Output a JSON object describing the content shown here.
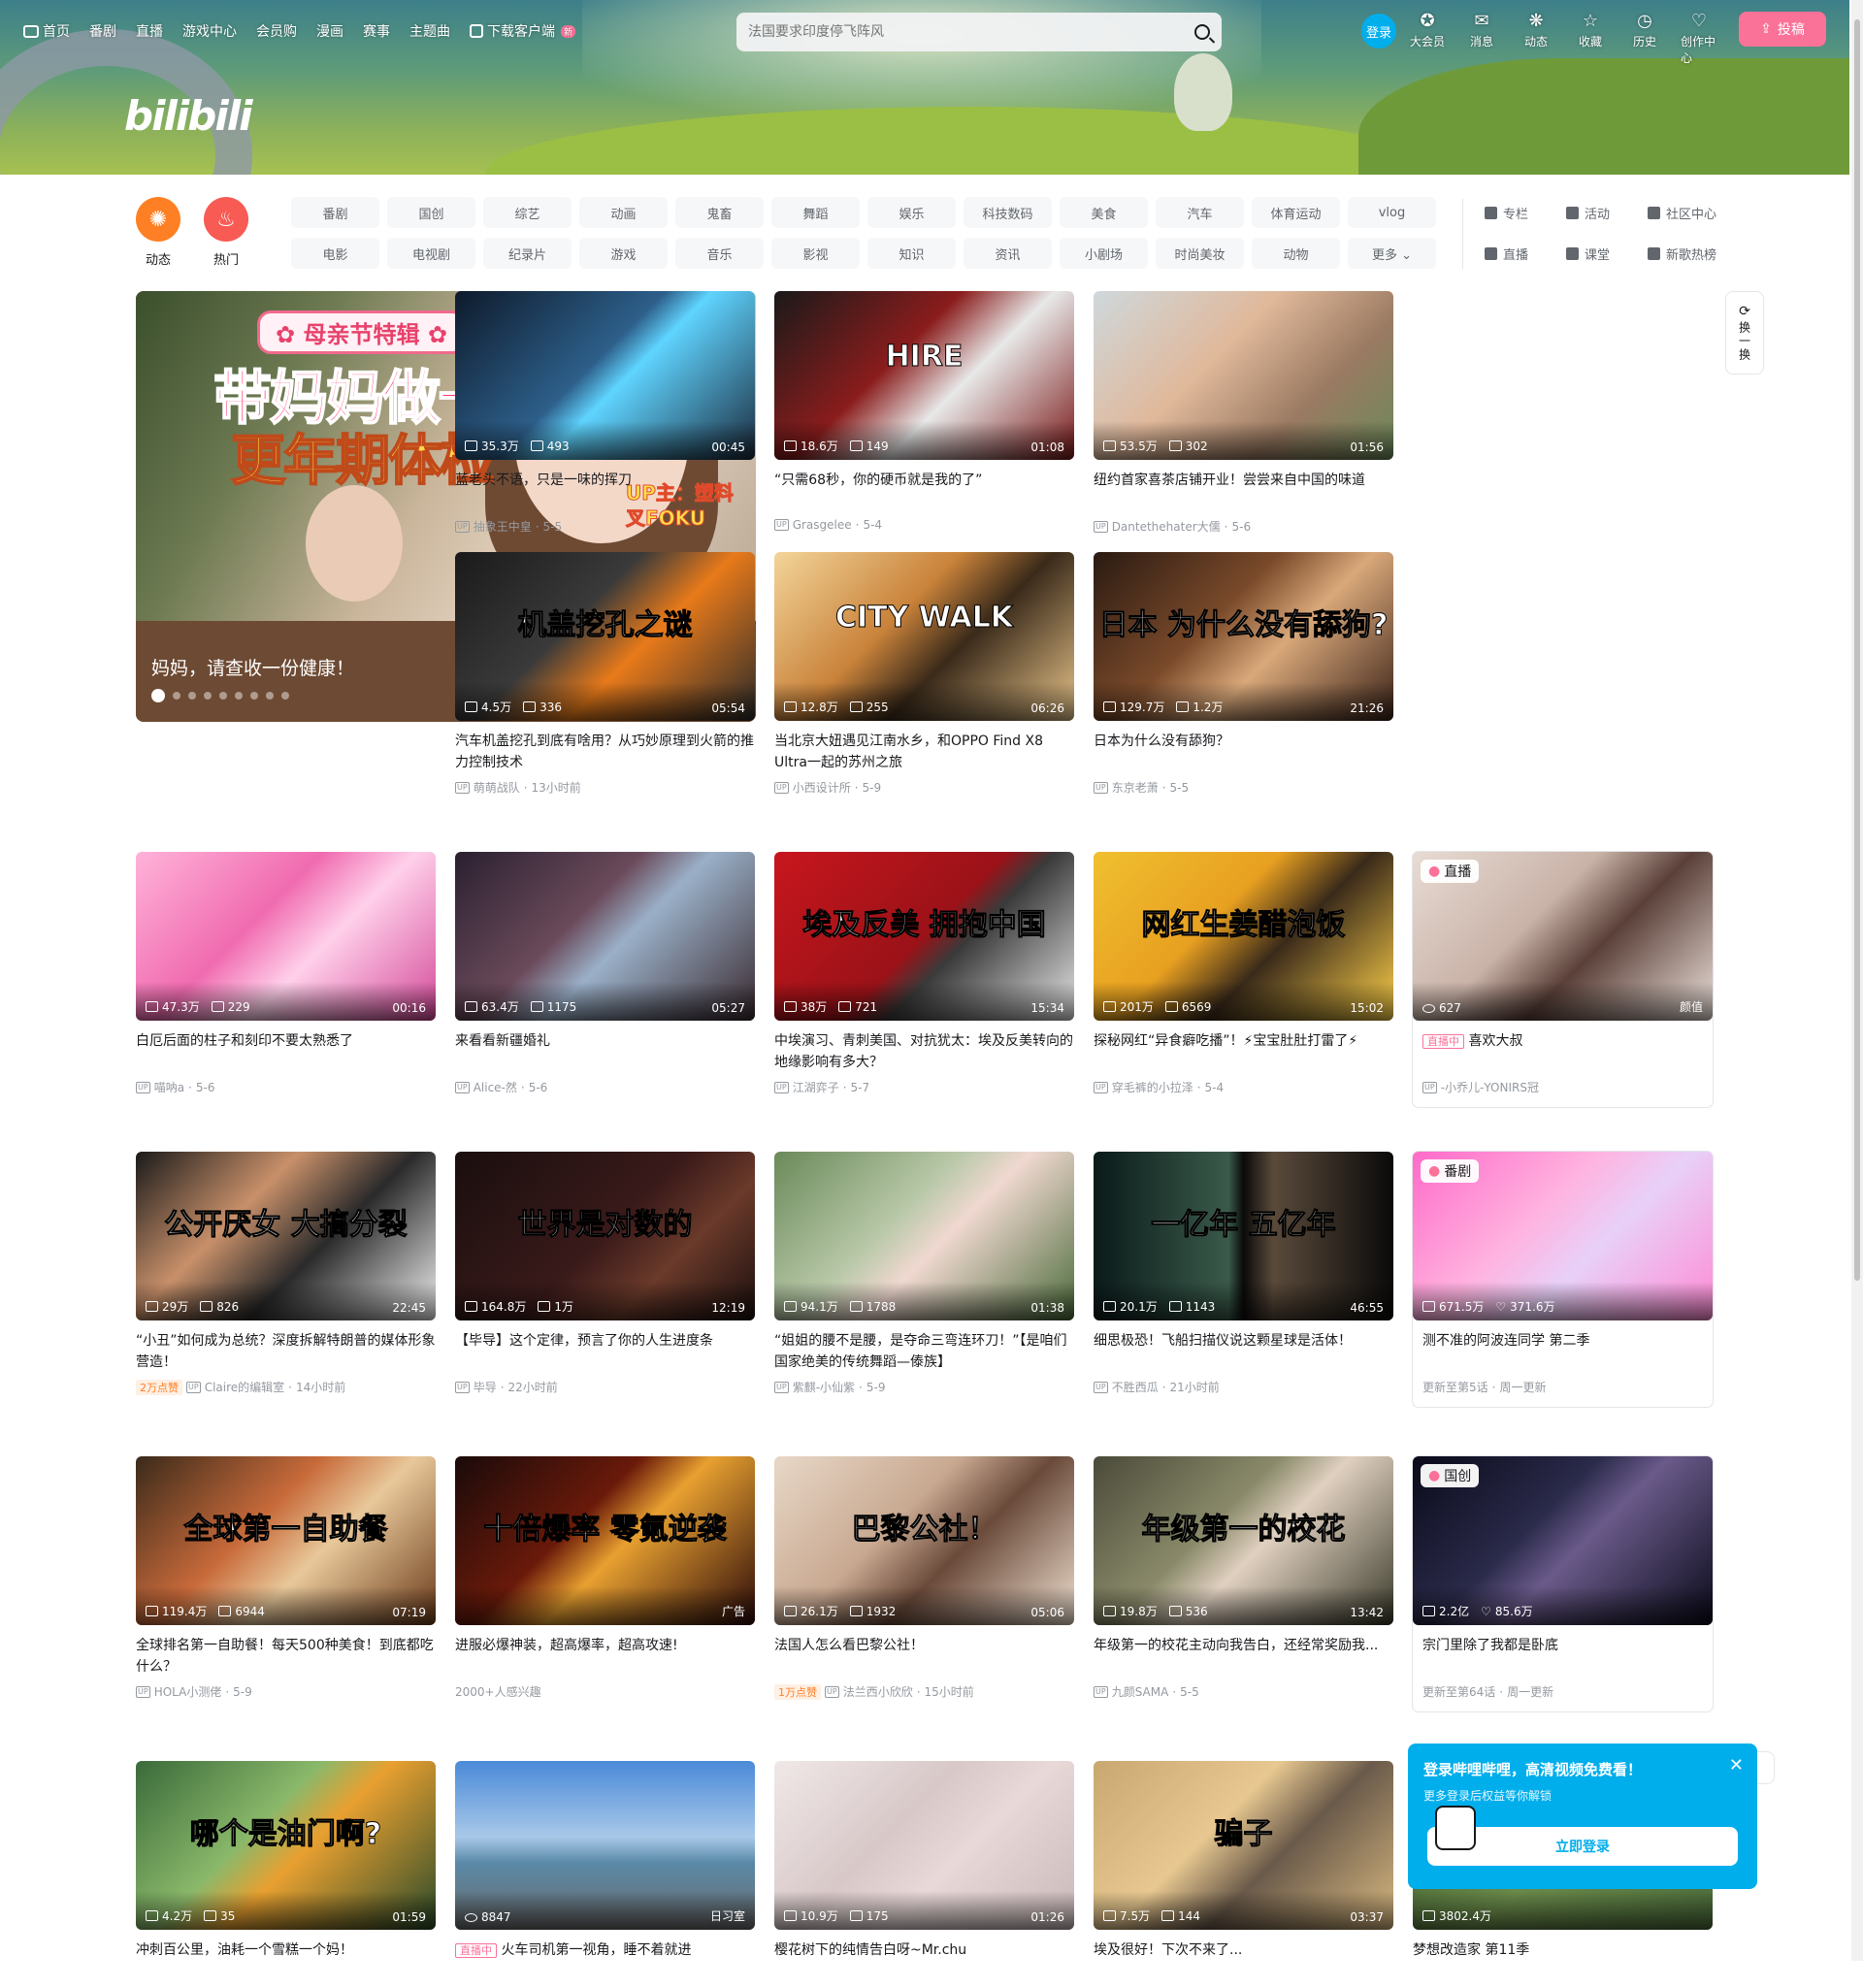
{
  "header": {
    "nav": [
      "首页",
      "番剧",
      "直播",
      "游戏中心",
      "会员购",
      "漫画",
      "赛事",
      "主题曲",
      "下载客户端"
    ],
    "new_badge": "新",
    "search_placeholder": "法国要求印度停飞阵风",
    "login": "登录",
    "icons": [
      {
        "label": "大会员",
        "glyph": "✪"
      },
      {
        "label": "消息",
        "glyph": "✉"
      },
      {
        "label": "动态",
        "glyph": "❋"
      },
      {
        "label": "收藏",
        "glyph": "☆"
      },
      {
        "label": "历史",
        "glyph": "◷"
      },
      {
        "label": "创作中心",
        "glyph": "♡"
      }
    ],
    "upload": "投稿",
    "logo": "bilibili"
  },
  "channels": {
    "round": [
      {
        "label": "动态",
        "color": "#ff7f24",
        "glyph": "✺"
      },
      {
        "label": "热门",
        "color": "#f85a54",
        "glyph": "♨"
      }
    ],
    "grid": [
      "番剧",
      "国创",
      "综艺",
      "动画",
      "鬼畜",
      "舞蹈",
      "娱乐",
      "科技数码",
      "美食",
      "汽车",
      "体育运动",
      "vlog",
      "电影",
      "电视剧",
      "纪录片",
      "游戏",
      "音乐",
      "影视",
      "知识",
      "资讯",
      "小剧场",
      "时尚美妆",
      "动物",
      "更多 ⌄"
    ],
    "right": [
      "专栏",
      "活动",
      "社区中心",
      "直播",
      "课堂",
      "新歌热榜"
    ]
  },
  "carousel": {
    "tag": "✿ 母亲节特辑 ✿",
    "line1": "带妈妈做一下",
    "line2": "更年期体检",
    "up": "UP主：塑料叉FOKU",
    "caption": "妈妈，请查收一份健康！",
    "dots": 9,
    "prev": "‹",
    "next": "›"
  },
  "refresh": "换一换",
  "cards": [
    {
      "title": "蓝老头不语，只是一味的挥刀",
      "views": "35.3万",
      "danmaku": "493",
      "duration": "00:45",
      "author": "抽象王中皇",
      "date": "5-5",
      "bg": "linear-gradient(135deg,#0e1a2b,#2d5f8a 45%,#5fd4ff 55%,#1b2b3d)"
    },
    {
      "title": "“只需68秒，你的硬币就是我的了”",
      "views": "18.6万",
      "danmaku": "149",
      "duration": "01:08",
      "author": "Grasgelee",
      "date": "5-4",
      "bg": "linear-gradient(135deg,#1a1a1a,#8a1c1c 40%,#e8e8e8 60%,#7a1818)",
      "text": "HIRE"
    },
    {
      "title": "纽约首家喜茶店铺开业！尝尝来自中国的味道",
      "views": "53.5万",
      "danmaku": "302",
      "duration": "01:56",
      "author": "Dantethehater大儒",
      "date": "5-6",
      "bg": "linear-gradient(135deg,#cfd8dc,#e0b89a 40%,#9a7a62 70%,#6b8a5a)"
    },
    {
      "title": "汽车机盖挖孔到底有啥用？从巧妙原理到火箭的推力控制技术",
      "views": "4.5万",
      "danmaku": "336",
      "duration": "05:54",
      "author": "萌萌战队",
      "date": "13小时前",
      "bg": "linear-gradient(135deg,#1a1a1a,#3a3a3a 40%,#e87a1a 60%,#2a2a2a)",
      "text": "机盖挖孔之谜"
    },
    {
      "title": "当北京大妞遇见江南水乡，和OPPO Find X8 Ultra一起的苏州之旅",
      "views": "12.8万",
      "danmaku": "255",
      "duration": "06:26",
      "author": "小西设计所",
      "date": "5-9",
      "bg": "linear-gradient(135deg,#f3d59a,#c9823a 40%,#3a2a1a 60%,#e8c48a)",
      "text": "CITY WALK"
    },
    {
      "title": "日本为什么没有舔狗？",
      "views": "129.7万",
      "danmaku": "1.2万",
      "duration": "21:26",
      "author": "东京老萧",
      "date": "5-5",
      "bg": "linear-gradient(135deg,#2a1a12,#7a4a2a 40%,#d9a87a 60%,#3a2218)",
      "text": "日本 为什么没有舔狗?"
    },
    {
      "title": "白厄后面的柱子和刻印不要太熟悉了",
      "views": "47.3万",
      "danmaku": "229",
      "duration": "00:16",
      "author": "喵呐a",
      "date": "5-6",
      "bg": "linear-gradient(135deg,#ffb3d9,#f06bb0 40%,#ffd0ea 60%,#d44a9a)"
    },
    {
      "title": "来看看新疆婚礼",
      "views": "63.4万",
      "danmaku": "1175",
      "duration": "05:27",
      "author": "Alice-然",
      "date": "5-6",
      "bg": "linear-gradient(135deg,#2a2030,#6a4a5a 40%,#9ab0c8 55%,#3a2a30)"
    },
    {
      "title": "中埃演习、青刺美国、对抗犹太：埃及反美转向的地缘影响有多大？",
      "views": "38万",
      "danmaku": "721",
      "duration": "15:34",
      "author": "江湖弈子",
      "date": "5-7",
      "bg": "linear-gradient(135deg,#c8161d,#9a1218 50%,#3a3a3a 60%,#e8e8e8)",
      "text": "埃及反美 拥抱中国"
    },
    {
      "title": "探秘网红“异食癖吃播”！⚡宝宝肚肚打雷了⚡",
      "views": "201万",
      "danmaku": "6569",
      "duration": "15:02",
      "author": "穿毛裤的小拉泽",
      "date": "5-4",
      "bg": "linear-gradient(135deg,#f0c030,#e8a020 40%,#3a2a1a 60%,#ffd24a)",
      "text": "网红生姜醋泡饭"
    },
    {
      "title": "喜欢大叔",
      "views": "627",
      "author": "-小乔儿-YONIRS冠",
      "pill": "直播",
      "live": "直播中",
      "tag": "颜值",
      "bg": "linear-gradient(135deg,#e8dcd4,#c9b2a8 40%,#5a4038 60%,#f0e4de)"
    },
    {
      "title": "“小丑”如何成为总统？深度拆解特朗普的媒体形象营造！",
      "views": "29万",
      "danmaku": "826",
      "duration": "22:45",
      "author": "Claire的编辑室",
      "date": "14小时前",
      "hot": "2万点赞",
      "bg": "linear-gradient(135deg,#1a1a1a,#c8906a 35%,#2a2a2a 60%,#f2f2f2)",
      "text": "公开厌女 大搞分裂"
    },
    {
      "title": "【毕导】这个定律，预言了你的人生进度条",
      "views": "164.8万",
      "danmaku": "1万",
      "duration": "12:19",
      "author": "毕导",
      "date": "22小时前",
      "bg": "linear-gradient(135deg,#1a0e0e,#3a1a1a 50%,#6a3a2a 70%,#1a0e0e)",
      "text": "世界是对数的"
    },
    {
      "title": "“姐姐的腰不是腰，是夺命三弯连环刀！”【是咱们国家绝美的传统舞蹈—傣族】",
      "views": "94.1万",
      "danmaku": "1788",
      "duration": "01:38",
      "author": "紫麒-小仙紫",
      "date": "5-9",
      "bg": "linear-gradient(135deg,#6a8a5a,#b8c8a8 40%,#f0d8d0 55%,#4a6a3a)"
    },
    {
      "title": "细思极恐！飞船扫描仪说这颗星球是活体！",
      "views": "20.1万",
      "danmaku": "1143",
      "duration": "46:55",
      "author": "不胜西瓜",
      "date": "21小时前",
      "bg": "linear-gradient(90deg,#0a1a1a,#3a5a4a 45%,#0a0a0a 50%,#5a4a3a 60%,#0a0a0a)",
      "text": "一亿年    五亿年"
    },
    {
      "title": "测不准的阿波连同学 第二季",
      "views": "671.5万",
      "likes": "371.6万",
      "sub": "更新至第5话",
      "sub2": "周一更新",
      "pill": "番剧",
      "bg": "linear-gradient(135deg,#ff6ac8,#ffb3e0 40%,#e8d0f8 60%,#ff8ad4)"
    },
    {
      "title": "全球排名第一自助餐！每天500种美食！到底都吃什么？",
      "views": "119.4万",
      "danmaku": "6944",
      "duration": "07:19",
      "author": "HOLA小测佬",
      "date": "5-9",
      "bg": "linear-gradient(135deg,#3a2a1a,#c86a3a 40%,#e8c89a 60%,#6a3a1a)",
      "text": "全球第一自助餐"
    },
    {
      "title": "进服必爆神装，超高爆率，超高攻速!",
      "sub": "2000+人感兴趣",
      "ad": "广告",
      "bg": "linear-gradient(135deg,#1a0a0a,#6a1a0a 40%,#e8a030 55%,#2a0a0a)",
      "text": "十倍爆率 零氪逆袭"
    },
    {
      "title": "法国人怎么看巴黎公社！",
      "views": "26.1万",
      "danmaku": "1932",
      "duration": "05:06",
      "author": "法兰西小欣欣",
      "date": "15小时前",
      "hot": "1万点赞",
      "bg": "linear-gradient(135deg,#e8d8c8,#c8a890 40%,#6a4a3a 60%,#f0e0d0)",
      "text": "巴黎公社！"
    },
    {
      "title": "年级第一的校花主动向我告白，还经常奖励我...",
      "views": "19.8万",
      "danmaku": "536",
      "duration": "13:42",
      "author": "九颜SAMA",
      "date": "5-5",
      "bg": "linear-gradient(135deg,#4a4a3a,#8a8a6a 40%,#e0d0c0 55%,#3a3a2a)",
      "text": "年级第一的校花"
    },
    {
      "title": "宗门里除了我都是卧底",
      "views": "2.2亿",
      "likes": "85.6万",
      "sub": "更新至第64话",
      "sub2": "周一更新",
      "pill": "国创",
      "bg": "linear-gradient(135deg,#0a0a1a,#2a2a4a 40%,#6a5a8a 55%,#0a0a1a)"
    },
    {
      "title": "冲刺百公里，油耗一个雪糕一个妈！",
      "views": "4.2万",
      "danmaku": "35",
      "duration": "01:59",
      "bg": "linear-gradient(135deg,#3a6a3a,#8ab86a 40%,#e8a030 55%,#2a4a2a)",
      "text": "哪个是油门啊?"
    },
    {
      "title": "火车司机第一视角，睡不着就进",
      "views": "8847",
      "live": "直播中",
      "tag": "日习室",
      "bg": "linear-gradient(180deg,#4a8ad8,#a8c8e8 45%,#5a8aa8 60%,#6a6a6a)"
    },
    {
      "title": "樱花树下的纯情告白呀~Mr.chu",
      "views": "10.9万",
      "danmaku": "175",
      "duration": "01:26",
      "bg": "linear-gradient(135deg,#f0e8e8,#d8c8c8 40%,#e8d8d8 60%,#c8b8b8)"
    },
    {
      "title": "埃及很好！下次不来了...",
      "views": "7.5万",
      "danmaku": "144",
      "duration": "03:37",
      "bg": "linear-gradient(135deg,#c8a870,#e8c890 40%,#6a5a4a 60%,#d8b880)",
      "text": "骗子"
    },
    {
      "title": "梦想改造家 第11季",
      "views": "3802.4万",
      "bg": "linear-gradient(135deg,#3a5a2a,#6a8a4a 50%,#4a6a3a)"
    }
  ],
  "popup": {
    "title": "登录哔哩哔哩，高清视频免费看！",
    "sub": "更多登录后权益等你解锁",
    "button": "立即登录",
    "close": "✕"
  },
  "colors": {
    "accent": "#00aeec",
    "pink": "#fb7299"
  }
}
